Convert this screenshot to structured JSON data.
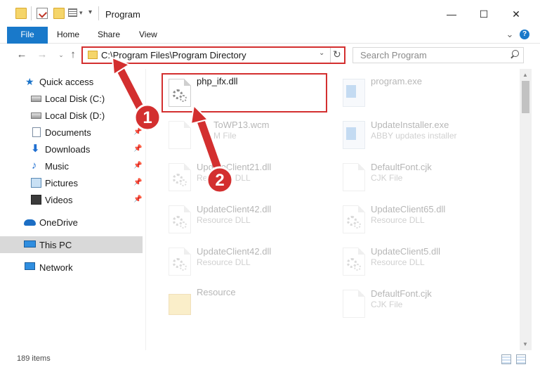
{
  "window": {
    "title": "Program",
    "minimize_glyph": "—",
    "maximize_glyph": "☐",
    "close_glyph": "✕"
  },
  "ribbon": {
    "tabs": [
      {
        "label": "File"
      },
      {
        "label": "Home"
      },
      {
        "label": "Share"
      },
      {
        "label": "View"
      }
    ],
    "help_glyph": "?"
  },
  "address": {
    "path": "C:\\Program Files\\Program Directory",
    "refresh_glyph": "↻"
  },
  "search": {
    "placeholder": "Search Program"
  },
  "sidebar": {
    "items": [
      {
        "label": "Quick access",
        "icon": "star-icon"
      },
      {
        "label": "Local Disk (C:)",
        "icon": "drive-icon"
      },
      {
        "label": "Local Disk (D:)",
        "icon": "drive-icon"
      },
      {
        "label": "Documents",
        "icon": "documents-icon",
        "pinned": true
      },
      {
        "label": "Downloads",
        "icon": "download-icon",
        "pinned": true
      },
      {
        "label": "Music",
        "icon": "music-icon",
        "pinned": true
      },
      {
        "label": "Pictures",
        "icon": "pictures-icon",
        "pinned": true
      },
      {
        "label": "Videos",
        "icon": "videos-icon",
        "pinned": true
      },
      {
        "label": "OneDrive",
        "icon": "cloud-icon"
      },
      {
        "label": "This PC",
        "icon": "computer-icon",
        "selected": true
      },
      {
        "label": "Network",
        "icon": "network-icon"
      }
    ]
  },
  "files": [
    {
      "name": "php_ifx.dll",
      "type": "",
      "highlighted": true
    },
    {
      "name": "program.exe",
      "type": ""
    },
    {
      "name": "ToWP13.wcm",
      "type": "M File"
    },
    {
      "name": "UpdateInstaller.exe",
      "type": "ABBY updates installer"
    },
    {
      "name": "UpdateClient21.dll",
      "type": "Resource DLL"
    },
    {
      "name": "DefaultFont.cjk",
      "type": "CJK File"
    },
    {
      "name": "UpdateClient42.dll",
      "type": "Resource DLL"
    },
    {
      "name": "UpdateClient65.dll",
      "type": "Resource DLL"
    },
    {
      "name": "UpdateClient42.dll",
      "type": "Resource DLL"
    },
    {
      "name": "UpdateClient5.dll",
      "type": "Resource DLL"
    },
    {
      "name": "Resource",
      "type": ""
    },
    {
      "name": "DefaultFont.cjk",
      "type": "CJK File"
    }
  ],
  "status": {
    "item_count": "189 items"
  },
  "annotations": {
    "step1": "1",
    "step2": "2",
    "color": "#d32f2f"
  }
}
